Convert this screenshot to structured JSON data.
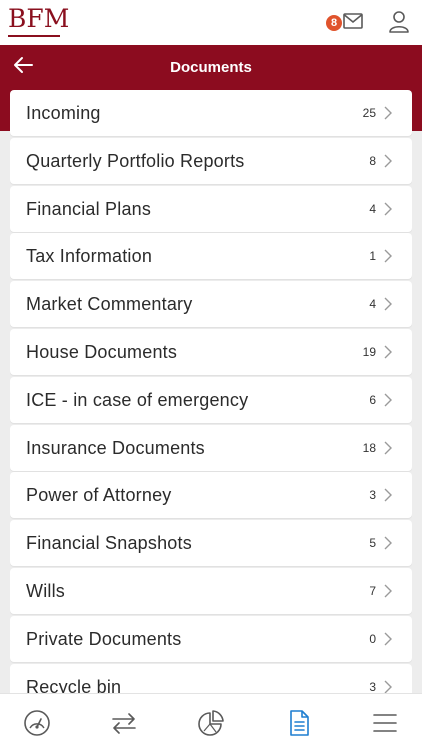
{
  "app": {
    "logo_text": "BFM",
    "notification_count": "8"
  },
  "header": {
    "title": "Documents"
  },
  "documents": [
    {
      "label": "Incoming",
      "count": "25"
    },
    {
      "label": "Quarterly Portfolio Reports",
      "count": "8"
    },
    {
      "label": "Financial Plans",
      "count": "4"
    },
    {
      "label": "Tax Information",
      "count": "1"
    },
    {
      "label": "Market Commentary",
      "count": "4"
    },
    {
      "label": "House Documents",
      "count": "19"
    },
    {
      "label": "ICE - in case of emergency",
      "count": "6"
    },
    {
      "label": "Insurance Documents",
      "count": "18"
    },
    {
      "label": "Power of Attorney",
      "count": "3"
    },
    {
      "label": "Financial Snapshots",
      "count": "5"
    },
    {
      "label": "Wills",
      "count": "7"
    },
    {
      "label": "Private Documents",
      "count": "0"
    },
    {
      "label": "Recycle bin",
      "count": "3"
    }
  ],
  "bottom_nav": {
    "items": [
      {
        "icon": "dashboard-gauge-icon",
        "active": false
      },
      {
        "icon": "transfer-arrows-icon",
        "active": false
      },
      {
        "icon": "pie-chart-icon",
        "active": false
      },
      {
        "icon": "document-icon",
        "active": true
      },
      {
        "icon": "menu-icon",
        "active": false
      }
    ]
  },
  "colors": {
    "brand": "#8c0c1f",
    "badge": "#e0532c",
    "active_nav": "#1f7fd1",
    "background": "#ededed"
  }
}
